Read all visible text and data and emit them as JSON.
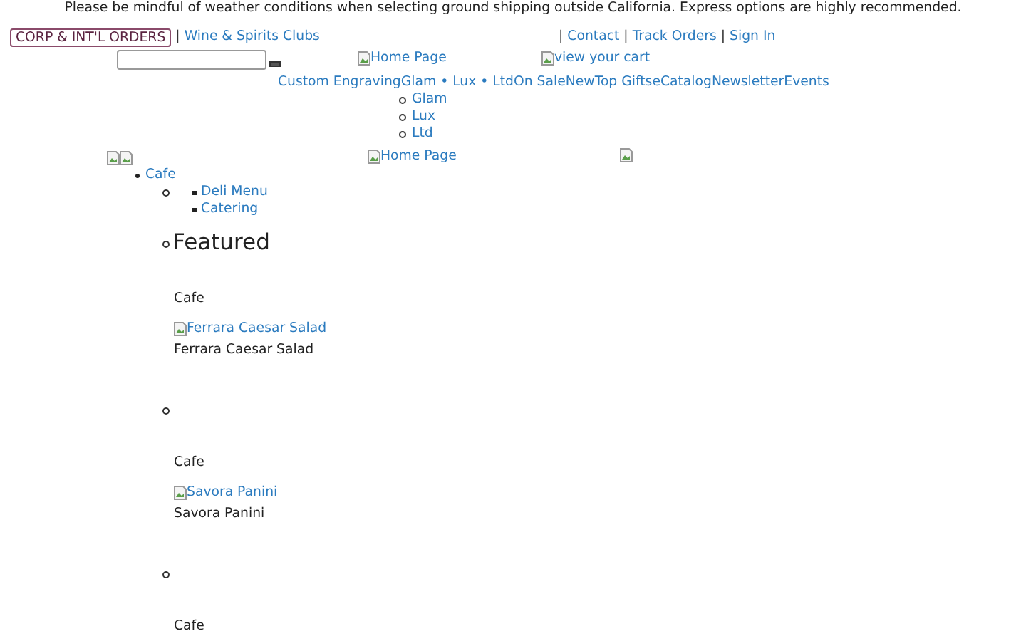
{
  "notice": "Please be mindful of weather conditions when selecting ground shipping outside California. Express options are highly recommended.",
  "top_bar": {
    "corp_button": "CORP & INT'L ORDERS",
    "left_links": [
      {
        "separator": "|",
        "text": "Wine & Spirits Clubs"
      }
    ],
    "right_links": [
      {
        "separator": "|",
        "text": "Contact"
      },
      {
        "separator": "|",
        "text": "Track Orders"
      },
      {
        "separator": "|",
        "text": "Sign In"
      }
    ]
  },
  "header": {
    "home_image_alt": "Home Page",
    "cart_link": "view your cart"
  },
  "nav": {
    "items": [
      "Custom Engraving",
      "Glam • Lux • Ltd",
      "On Sale",
      "New",
      "Top Gifts",
      "eCatalog",
      "Newsletter",
      "Events"
    ],
    "submenu": [
      "Glam",
      "Lux",
      "Ltd"
    ]
  },
  "banner": {
    "home_image_alt": "Home Page"
  },
  "menu": {
    "category": "Cafe",
    "subcategories": [
      "Deli Menu",
      "Catering"
    ],
    "featured_title": "Featured",
    "products": [
      {
        "category": "Cafe",
        "image_alt": "Ferrara Caesar Salad",
        "name": "Ferrara Caesar Salad"
      },
      {
        "category": "Cafe",
        "image_alt": "Savora Panini",
        "name": "Savora Panini"
      },
      {
        "category": "Cafe"
      }
    ]
  }
}
